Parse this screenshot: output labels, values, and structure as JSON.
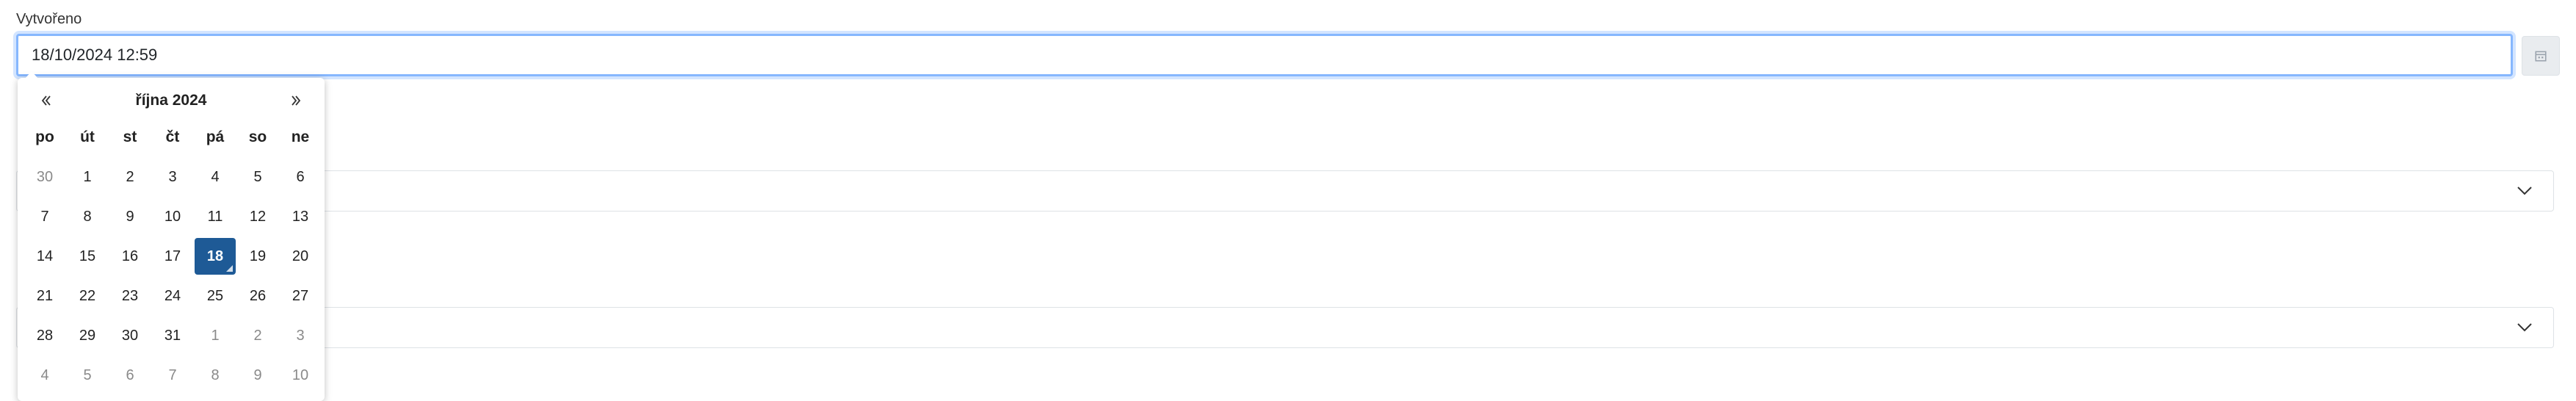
{
  "field": {
    "label": "Vytvořeno",
    "value": "18/10/2024 12:59"
  },
  "calendar_button": {
    "icon": "calendar-icon"
  },
  "select_1": {
    "value": "",
    "icon": "chevron-down-icon"
  },
  "select_2": {
    "value": "",
    "icon": "chevron-down-icon"
  },
  "picker": {
    "prev_icon": "double-chevron-left-icon",
    "next_icon": "double-chevron-right-icon",
    "month_title": "října 2024",
    "weekdays": [
      "po",
      "út",
      "st",
      "čt",
      "pá",
      "so",
      "ne"
    ],
    "weeks": [
      [
        "30",
        "1",
        "2",
        "3",
        "4",
        "5",
        "6"
      ],
      [
        "7",
        "8",
        "9",
        "10",
        "11",
        "12",
        "13"
      ],
      [
        "14",
        "15",
        "16",
        "17",
        "18",
        "19",
        "20"
      ],
      [
        "21",
        "22",
        "23",
        "24",
        "25",
        "26",
        "27"
      ],
      [
        "28",
        "29",
        "30",
        "31",
        "1",
        "2",
        "3"
      ],
      [
        "4",
        "5",
        "6",
        "7",
        "8",
        "9",
        "10"
      ]
    ],
    "selected_day": "18",
    "accent_color": "#1e5a96"
  }
}
